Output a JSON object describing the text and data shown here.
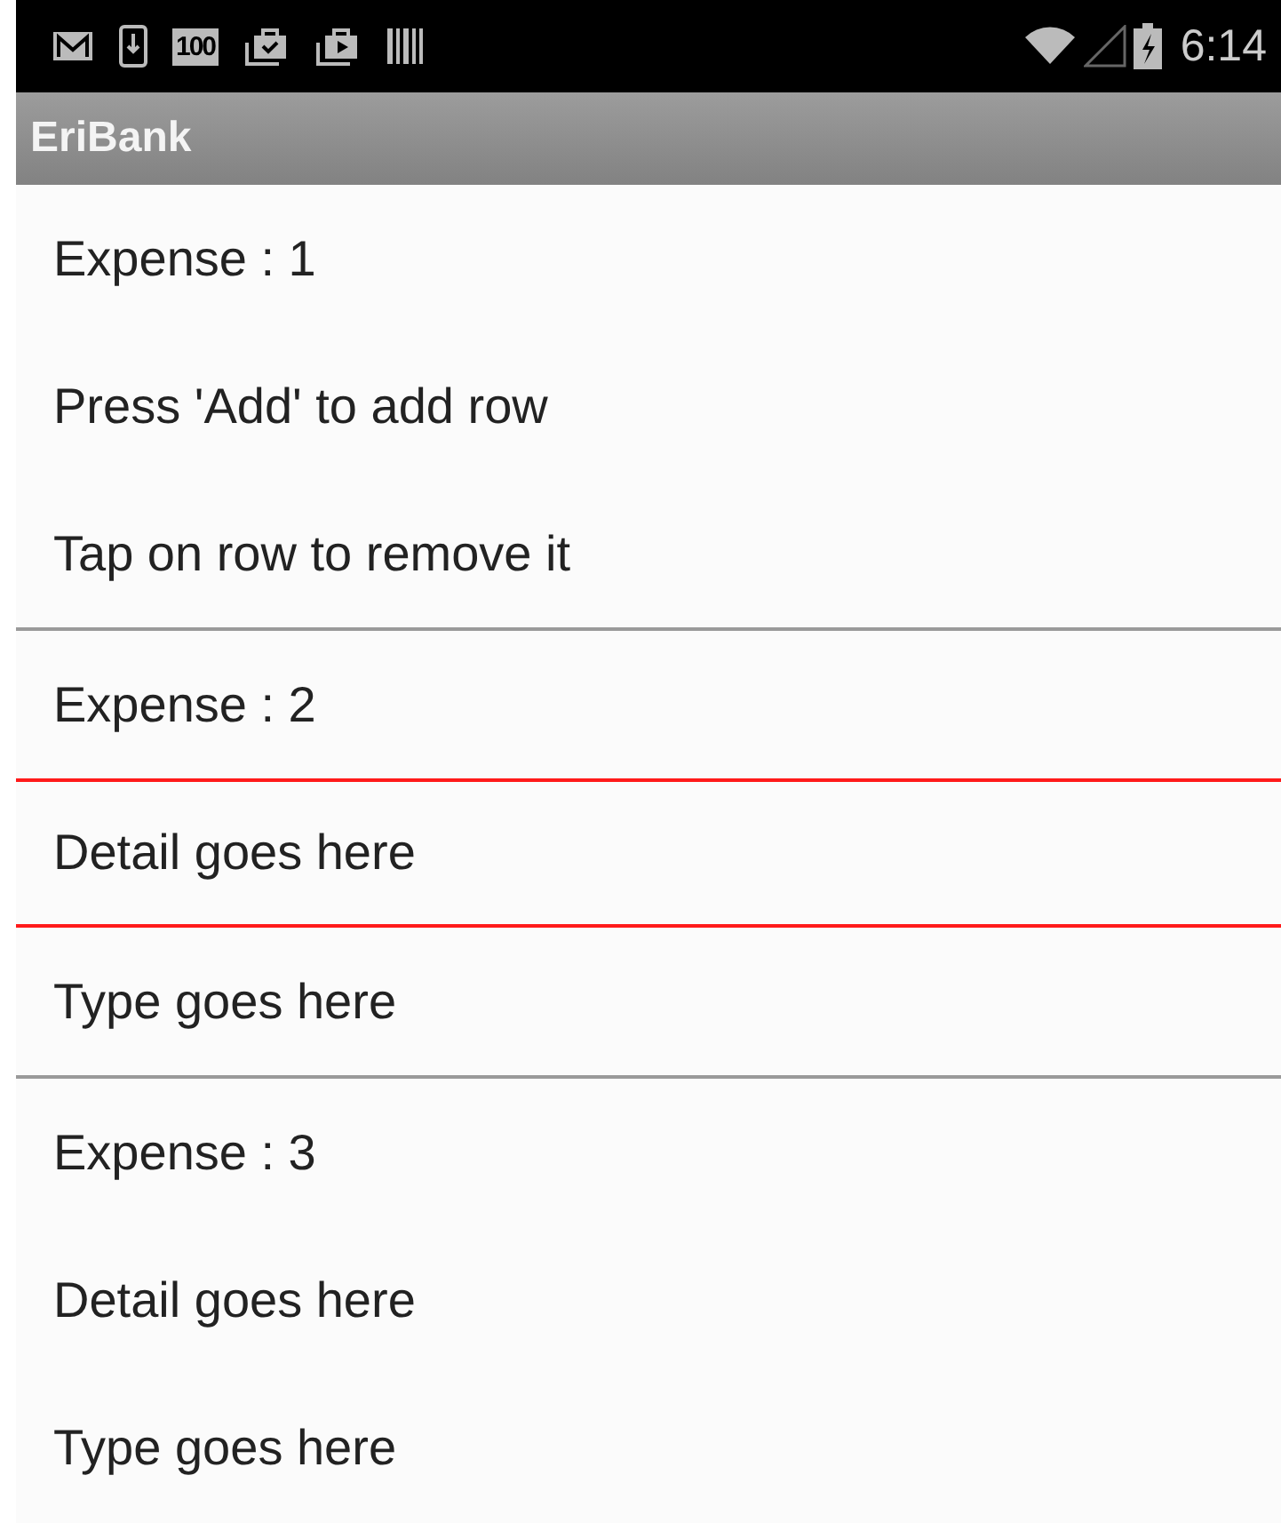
{
  "status_bar": {
    "notification_badge": "100",
    "time": "6:14"
  },
  "app_bar": {
    "title": "EriBank"
  },
  "expenses": [
    {
      "lines": [
        {
          "text": "Expense : 1",
          "selected": false
        },
        {
          "text": "Press 'Add' to add row",
          "selected": false
        },
        {
          "text": "Tap on row to remove it",
          "selected": false
        }
      ]
    },
    {
      "lines": [
        {
          "text": "Expense : 2",
          "selected": false
        },
        {
          "text": "Detail goes here",
          "selected": true
        },
        {
          "text": "Type goes here",
          "selected": false
        }
      ]
    },
    {
      "lines": [
        {
          "text": "Expense : 3",
          "selected": false
        },
        {
          "text": "Detail goes here",
          "selected": false
        },
        {
          "text": "Type goes here",
          "selected": false
        }
      ]
    }
  ]
}
